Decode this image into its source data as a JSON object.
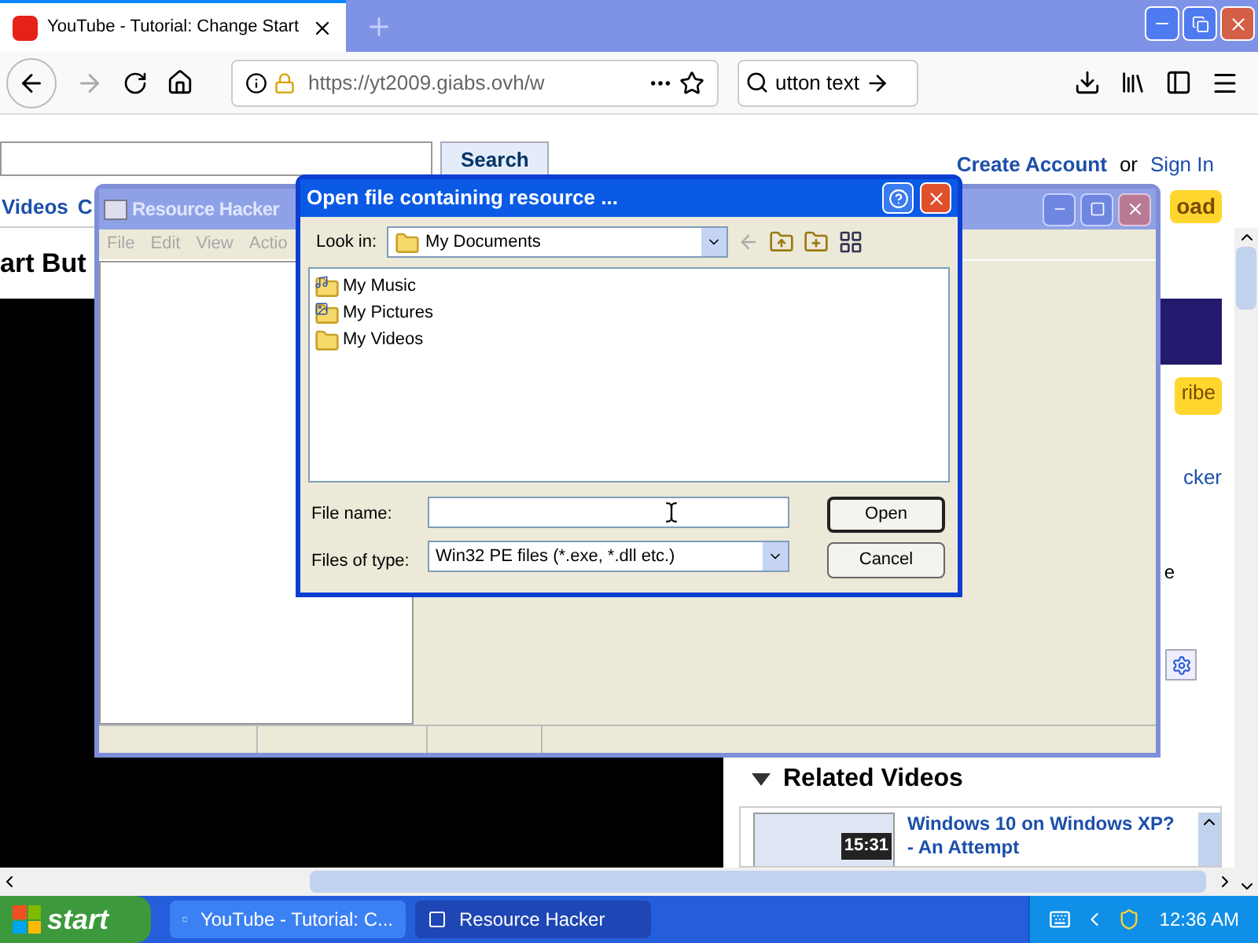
{
  "browser": {
    "tab": {
      "title": "YouTube - Tutorial: Change Start",
      "selected": true
    },
    "url": "https://yt2009.giabs.ovh/w",
    "search": {
      "value": "utton text"
    }
  },
  "page": {
    "search_button": "Search",
    "create_account": "Create Account",
    "or": "or",
    "sign_in": "Sign In",
    "nav": [
      "Videos",
      "C"
    ],
    "heading": "art But",
    "upload": "oad",
    "subscribe": "ribe",
    "side_link": "cker",
    "side_text": "e",
    "related": {
      "heading": "Related Videos",
      "videos": [
        {
          "title": "Windows 10 on Windows XP? - An Attempt",
          "duration": "15:31"
        }
      ]
    }
  },
  "resource_hacker": {
    "title": "Resource Hacker",
    "menu": [
      "File",
      "Edit",
      "View",
      "Actio"
    ]
  },
  "dialog": {
    "title": "Open file containing resource ...",
    "look_in_label": "Look in:",
    "look_in": "My Documents",
    "items": [
      {
        "kind": "music",
        "label": "My Music"
      },
      {
        "kind": "pictures",
        "label": "My Pictures"
      },
      {
        "kind": "videos",
        "label": "My Videos"
      }
    ],
    "file_name_label": "File name:",
    "file_type_label": "Files of type:",
    "file_type": "Win32 PE files (*.exe, *.dll etc.)",
    "buttons": [
      {
        "label": "Open",
        "default": true
      },
      {
        "label": "Cancel",
        "default": false
      }
    ]
  },
  "taskbar": {
    "start": "start",
    "tasks": [
      {
        "label": "YouTube - Tutorial: C...",
        "selected": false
      },
      {
        "label": "Resource Hacker",
        "selected": true
      }
    ],
    "clock": "12:36 AM"
  }
}
